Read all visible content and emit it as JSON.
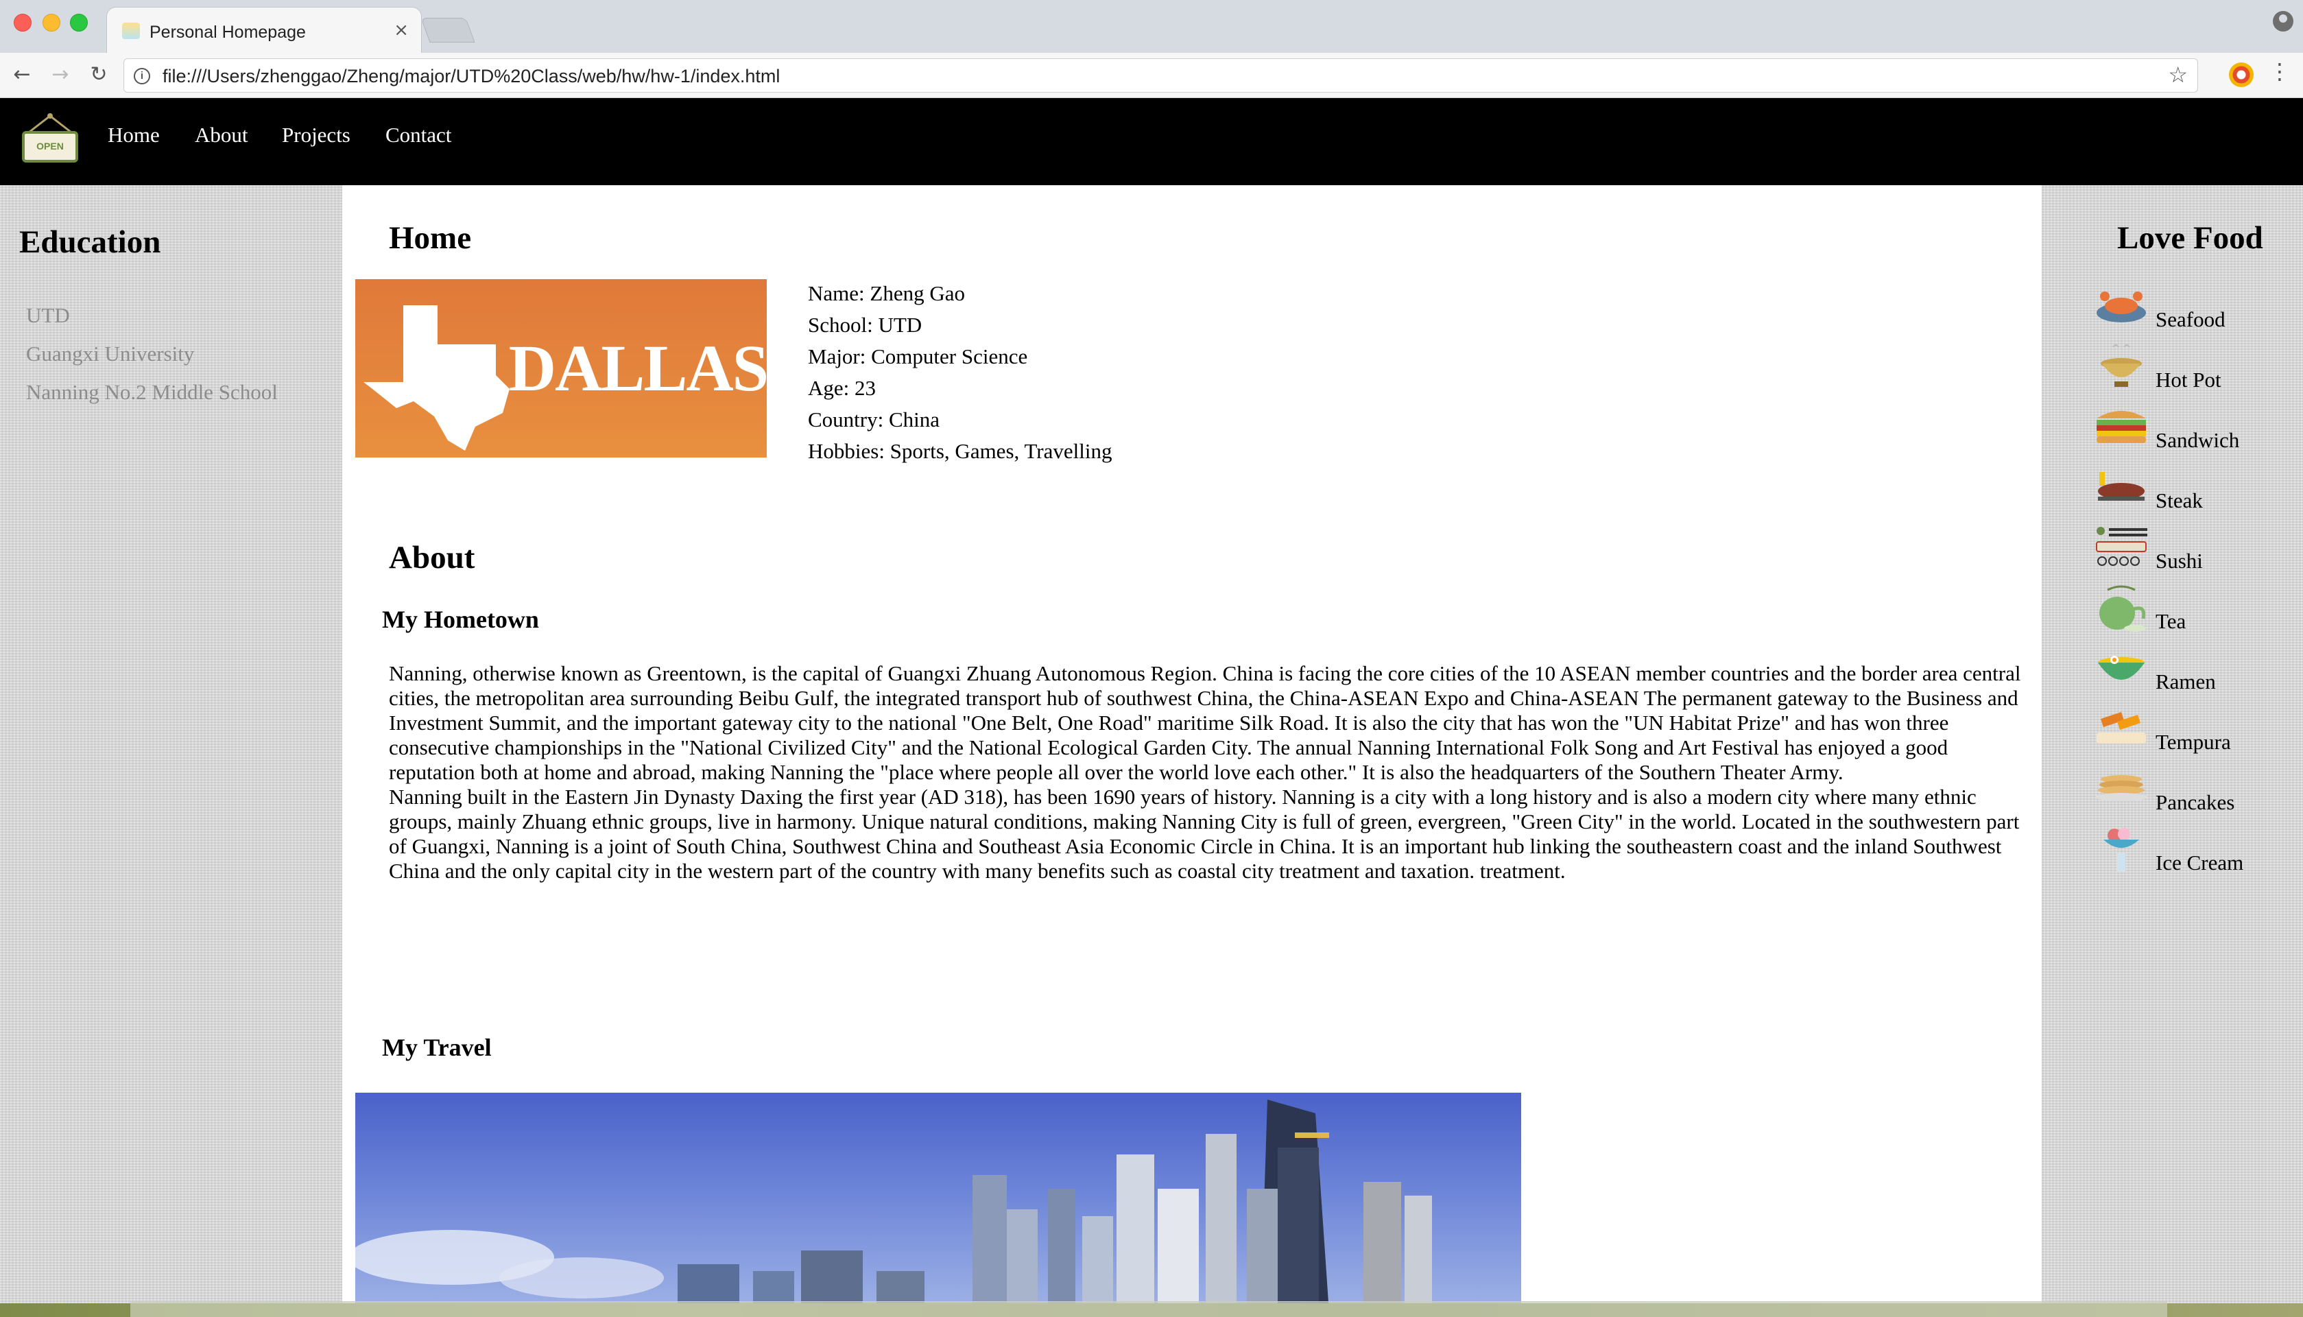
{
  "browser": {
    "tab_title": "Personal Homepage",
    "close_glyph": "×",
    "url": "file:///Users/zhenggao/Zheng/major/UTD%20Class/web/hw/hw-1/index.html"
  },
  "nav": {
    "logo_text": "OPEN",
    "links": [
      "Home",
      "About",
      "Projects",
      "Contact"
    ]
  },
  "education": {
    "title": "Education",
    "items": [
      "UTD",
      "Guangxi University",
      "Nanning No.2 Middle School"
    ]
  },
  "home": {
    "title": "Home",
    "logo_text": "UT DALLAS",
    "info": [
      "Name: Zheng Gao",
      "School: UTD",
      "Major: Computer Science",
      "Age: 23",
      "Country: China",
      "Hobbies: Sports, Games, Travelling"
    ]
  },
  "about": {
    "title": "About",
    "hometown_title": "My Hometown",
    "paragraph1": "Nanning, otherwise known as Greentown, is the capital of Guangxi Zhuang Autonomous Region. China is facing the core cities of the 10 ASEAN member countries and the border area central cities, the metropolitan area surrounding Beibu Gulf, the integrated transport hub of southwest China, the China-ASEAN Expo and China-ASEAN The permanent gateway to the Business and Investment Summit, and the important gateway city to the national \"One Belt, One Road\" maritime Silk Road. It is also the city that has won the \"UN Habitat Prize\" and has won three consecutive championships in the \"National Civilized City\" and the National Ecological Garden City. The annual Nanning International Folk Song and Art Festival has enjoyed a good reputation both at home and abroad, making Nanning the \"place where people all over the world love each other.\" It is also the headquarters of the Southern Theater Army.",
    "paragraph2": "Nanning built in the Eastern Jin Dynasty Daxing the first year (AD 318), has been 1690 years of history. Nanning is a city with a long history and is also a modern city where many ethnic groups, mainly Zhuang ethnic groups, live in harmony. Unique natural conditions, making Nanning City is full of green, evergreen, \"Green City\" in the world. Located in the southwestern part of Guangxi, Nanning is a joint of South China, Southwest China and Southeast Asia Economic Circle in China. It is an important hub linking the southeastern coast and the inland Southwest China and the only capital city in the western part of the country with many benefits such as coastal city treatment and taxation. treatment.",
    "travel_title": "My Travel"
  },
  "food": {
    "title": "Love Food",
    "items": [
      {
        "label": "Seafood",
        "icon": "seafood-icon"
      },
      {
        "label": "Hot Pot",
        "icon": "hot-pot-icon"
      },
      {
        "label": "Sandwich",
        "icon": "sandwich-icon"
      },
      {
        "label": "Steak",
        "icon": "steak-icon"
      },
      {
        "label": "Sushi",
        "icon": "sushi-icon"
      },
      {
        "label": "Tea",
        "icon": "tea-icon"
      },
      {
        "label": "Ramen",
        "icon": "ramen-icon"
      },
      {
        "label": "Tempura",
        "icon": "tempura-icon"
      },
      {
        "label": "Pancakes",
        "icon": "pancakes-icon"
      },
      {
        "label": "Ice Cream",
        "icon": "ice-cream-icon"
      }
    ]
  },
  "colors": {
    "nav_bg": "#000000",
    "utd_orange": "#e8843c",
    "muted_link": "#8c8c8c"
  }
}
